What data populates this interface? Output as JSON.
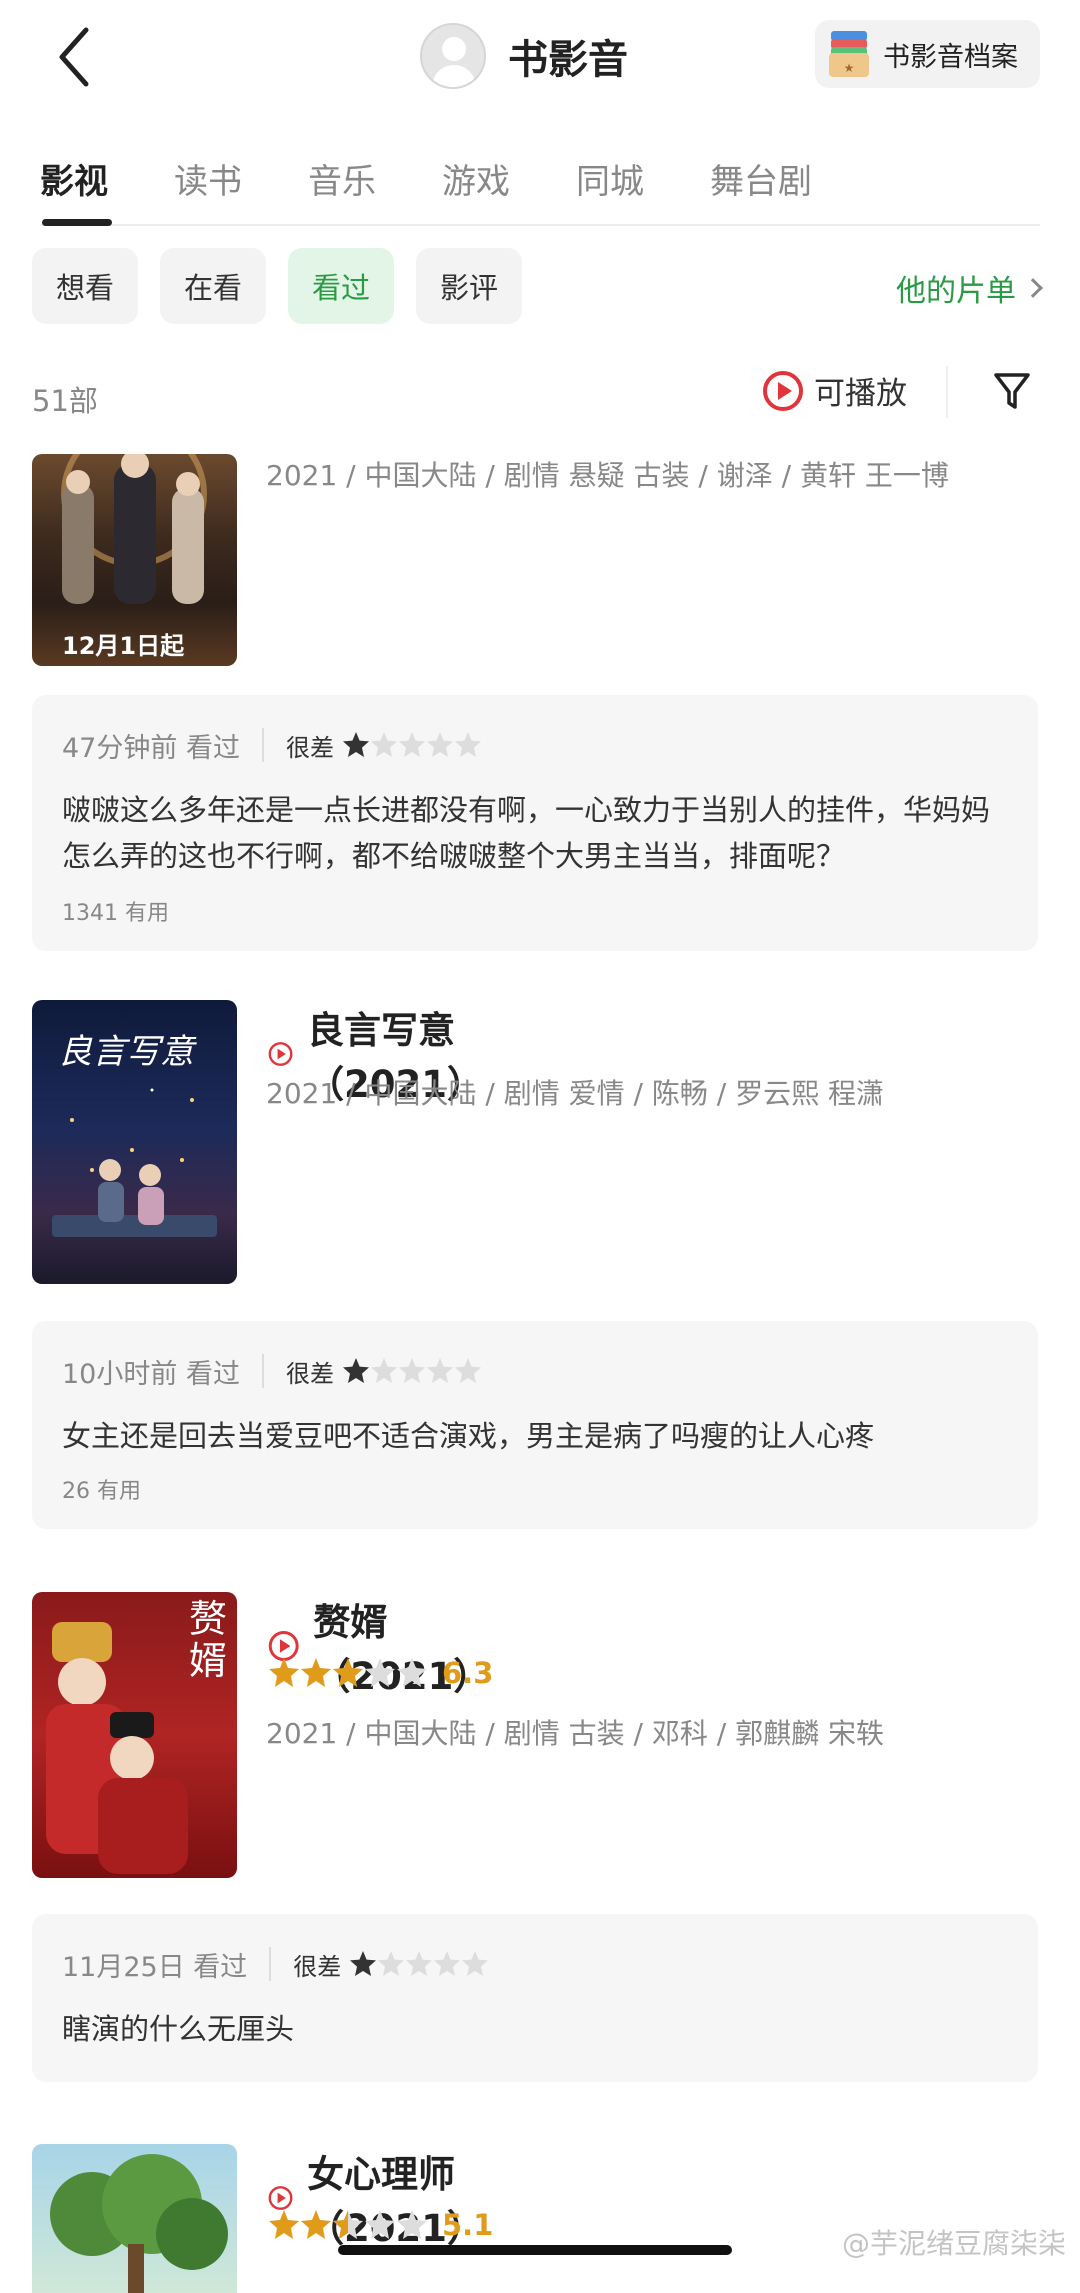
{
  "header": {
    "title": "书影音",
    "archive_label": "书影音档案"
  },
  "tabs": [
    "影视",
    "读书",
    "音乐",
    "游戏",
    "同城",
    "舞台剧"
  ],
  "chips": [
    "想看",
    "在看",
    "看过",
    "影评"
  ],
  "list_link": "他的片单",
  "count": "51部",
  "playable": "可播放",
  "movies": [
    {
      "meta": "2021 / 中国大陆 / 剧情 悬疑 古装 / 谢泽 / 黄轩 王一博",
      "poster_text": "12月1日起",
      "review": {
        "time": "47分钟前 看过",
        "label": "很差",
        "stars": 1,
        "text": "啵啵这么多年还是一点长进都没有啊，一心致力于当别人的挂件，华妈妈怎么弄的这也不行啊，都不给啵啵整个大男主当当，排面呢？",
        "useful": "1341 有用"
      }
    },
    {
      "title": "良言写意（2021）",
      "meta": "2021 / 中国大陆 / 剧情 爱情 / 陈畅 / 罗云熙 程潇",
      "poster_text": "良言写意",
      "review": {
        "time": "10小时前 看过",
        "label": "很差",
        "stars": 1,
        "text": "女主还是回去当爱豆吧不适合演戏，男主是病了吗瘦的让人心疼",
        "useful": "26 有用"
      }
    },
    {
      "title": "赘婿（2021）",
      "rating": "6.3",
      "rating_stars": 3,
      "meta": "2021 / 中国大陆 / 剧情 古装 / 邓科 / 郭麒麟 宋轶",
      "poster_text": "赘婿",
      "review": {
        "time": "11月25日 看过",
        "label": "很差",
        "stars": 1,
        "text": "瞎演的什么无厘头"
      }
    },
    {
      "title": "女心理师（2021）",
      "rating": "5.1",
      "rating_stars": 2.5
    }
  ],
  "watermark": "@芋泥绪豆腐柒柒",
  "colors": {
    "accent_green": "#2a9a45",
    "play_red": "#e0353a",
    "star_gold": "#e09b1b",
    "star_dark": "#333333"
  }
}
